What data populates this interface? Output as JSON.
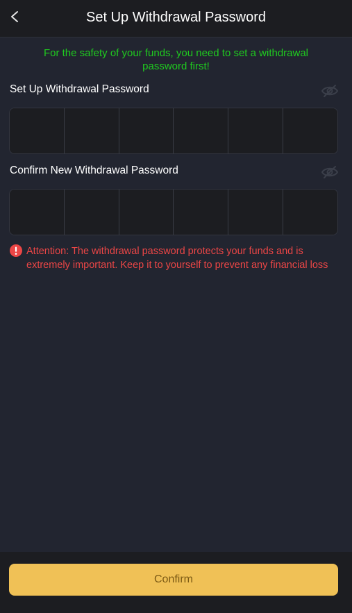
{
  "header": {
    "title": "Set Up Withdrawal Password",
    "back_icon": "chevron-left-icon"
  },
  "notice": "For the safety of your funds, you need to set a withdrawal password first!",
  "fields": {
    "password": {
      "label": "Set Up Withdrawal Password",
      "toggle_icon": "eye-off-icon",
      "digits": 6
    },
    "confirm": {
      "label": "Confirm New Withdrawal Password",
      "toggle_icon": "eye-off-icon",
      "digits": 6
    }
  },
  "attention": {
    "icon": "exclamation-circle-icon",
    "text": "Attention: The withdrawal password protects your funds and is extremely important. Keep it to yourself to prevent any financial loss"
  },
  "footer": {
    "confirm_label": "Confirm"
  },
  "colors": {
    "background": "#222530",
    "notice": "#1fcb1f",
    "warning": "#ec4646",
    "accent": "#f0c156"
  }
}
